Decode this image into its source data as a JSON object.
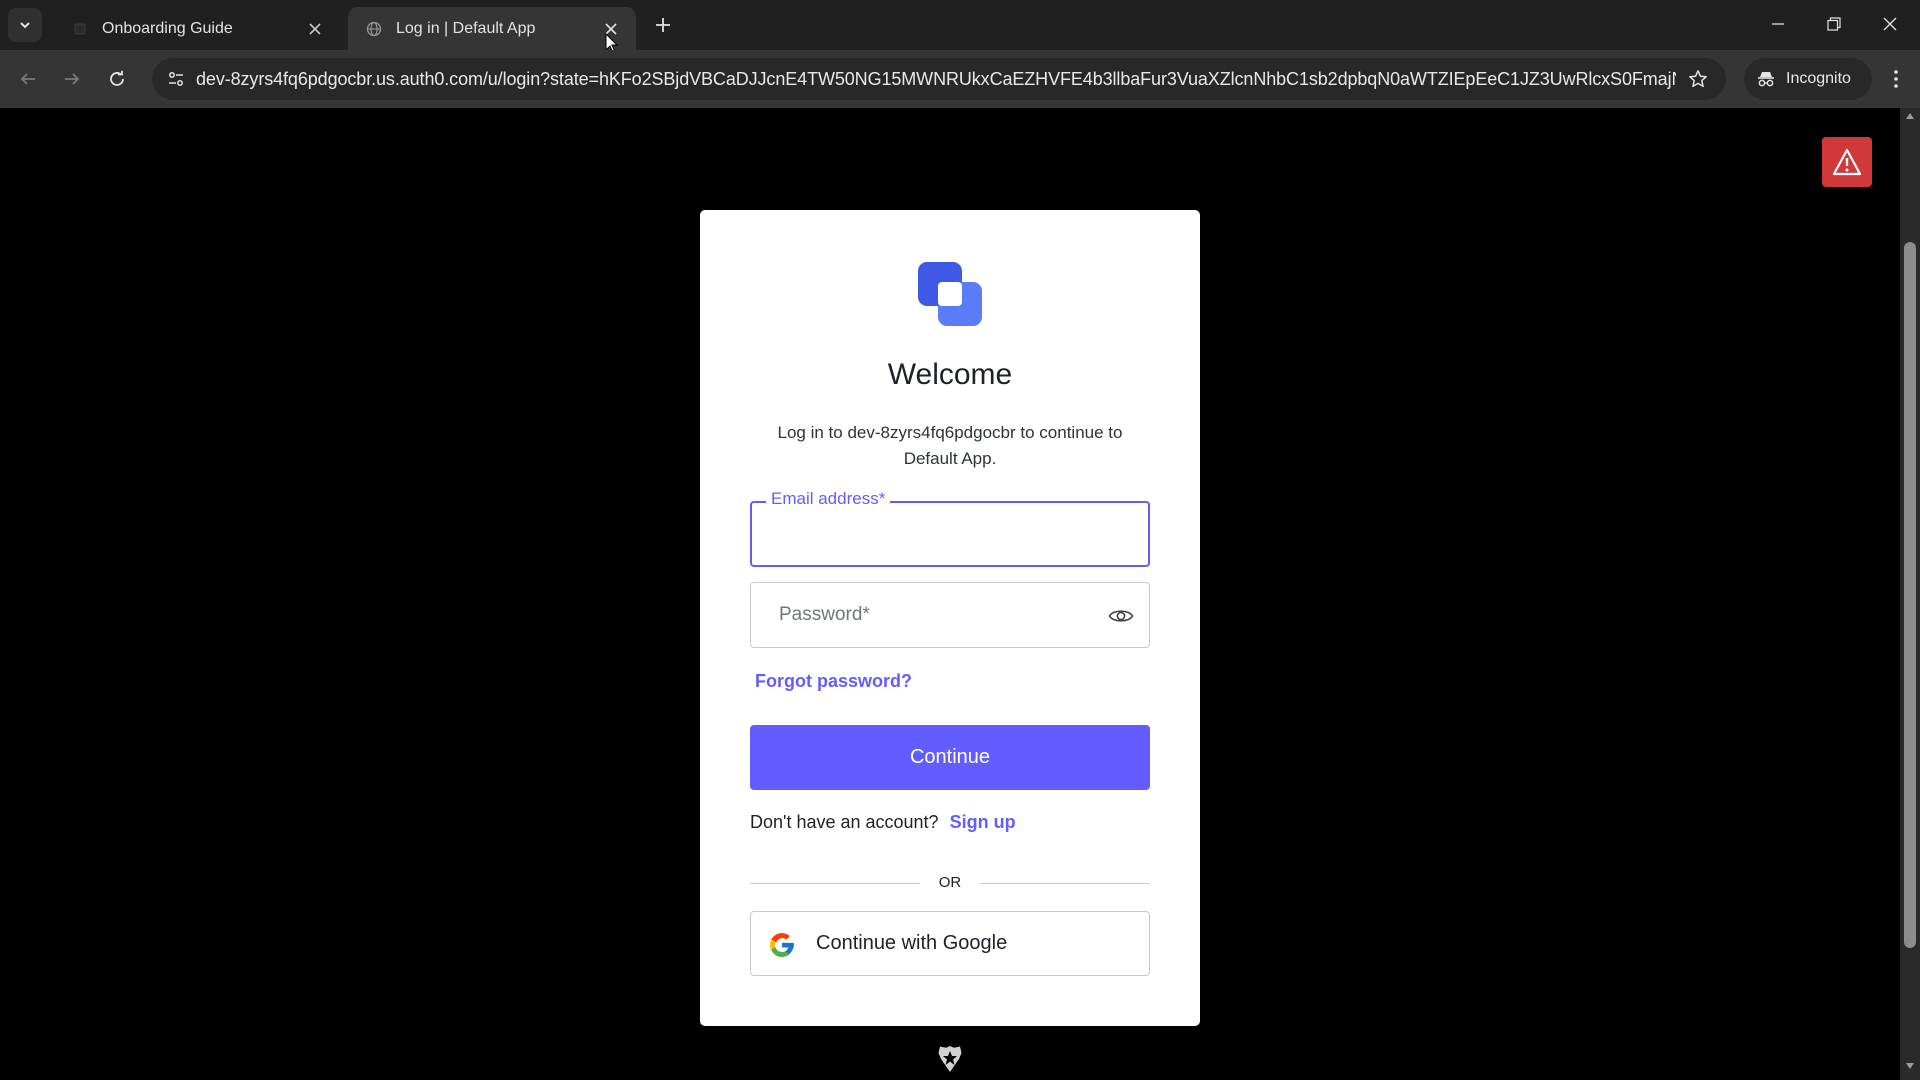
{
  "browser": {
    "tabs": [
      {
        "title": "Onboarding Guide",
        "active": false
      },
      {
        "title": "Log in | Default App",
        "active": true
      }
    ],
    "url": "dev-8zyrs4fq6pdgocbr.us.auth0.com/u/login?state=hKFo2SBjdVBCaDJJcnE4TW50NG15MWNRUkxCaEZHVFE4b3llbaFur3VuaXZlcnNhbC1sb2dpbqN0aWTZIEpEeC1JZ3UwRlcxS0FmajNZRUlibG...",
    "profile_label": "Incognito",
    "icons": [
      "tab-search-icon",
      "close-icon",
      "plus-icon",
      "minimize-icon",
      "restore-icon",
      "back-icon",
      "forward-icon",
      "reload-icon",
      "site-settings-icon",
      "star-icon",
      "incognito-icon",
      "kebab-menu-icon"
    ]
  },
  "login": {
    "title": "Welcome",
    "subtitle": "Log in to dev-8zyrs4fq6pdgocbr to continue to Default App.",
    "email_label": "Email address*",
    "email_value": "",
    "password_placeholder": "Password*",
    "forgot_label": "Forgot password?",
    "continue_label": "Continue",
    "signup_prompt": "Don't have an account?",
    "signup_label": "Sign up",
    "divider_label": "OR",
    "google_label": "Continue with Google"
  },
  "colors": {
    "accent": "#635dff",
    "warning": "#d0383a",
    "logo_back": "#3f59e4",
    "logo_front": "#5b7cf7"
  }
}
